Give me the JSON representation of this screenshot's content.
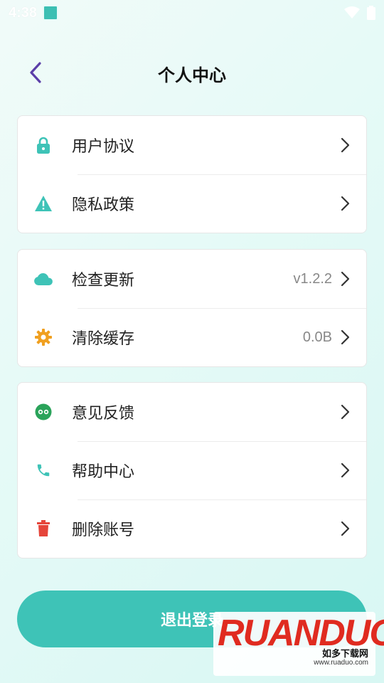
{
  "status_bar": {
    "time": "4:38"
  },
  "header": {
    "title": "个人中心"
  },
  "groups": [
    {
      "items": [
        {
          "label": "用户协议",
          "icon": "lock-icon",
          "color": "#3ec3b7",
          "value": ""
        },
        {
          "label": "隐私政策",
          "icon": "warning-icon",
          "color": "#3ec3b7",
          "value": ""
        }
      ]
    },
    {
      "items": [
        {
          "label": "检查更新",
          "icon": "cloud-icon",
          "color": "#3ec3b7",
          "value": "v1.2.2"
        },
        {
          "label": "清除缓存",
          "icon": "gear-icon",
          "color": "#f0a020",
          "value": "0.0B"
        }
      ]
    },
    {
      "items": [
        {
          "label": "意见反馈",
          "icon": "feedback-icon",
          "color": "#2aa35a",
          "value": ""
        },
        {
          "label": "帮助中心",
          "icon": "phone-icon",
          "color": "#3ec3b7",
          "value": ""
        },
        {
          "label": "删除账号",
          "icon": "trash-icon",
          "color": "#e5453a",
          "value": ""
        }
      ]
    }
  ],
  "logout": {
    "label": "退出登录"
  },
  "watermark": {
    "logo": "RUANDUO",
    "sub": "如多下载网",
    "url": "www.ruaduo.com"
  },
  "colors": {
    "accent": "#3ec3b7",
    "back_arrow": "#5b3fa8"
  }
}
